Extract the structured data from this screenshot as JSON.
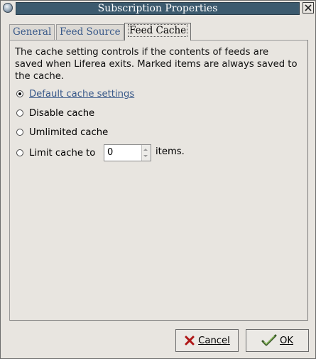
{
  "window": {
    "title": "Subscription Properties"
  },
  "tabs": [
    {
      "label": "General",
      "active": false
    },
    {
      "label": "Feed Source",
      "active": false
    },
    {
      "label": "Feed Cache",
      "active": true
    }
  ],
  "cache": {
    "description": "The cache setting controls if the contents of feeds are saved when Liferea exits. Marked items are always saved to the cache.",
    "options": [
      {
        "label": "Default cache settings",
        "accel": "D",
        "checked": true
      },
      {
        "label": "Disable cache",
        "accel": "s",
        "checked": false
      },
      {
        "label": "Umlimited cache",
        "accel": "U",
        "checked": false
      },
      {
        "label": "Limit cache to",
        "accel": "L",
        "checked": false
      }
    ],
    "limit_value": "0",
    "items_suffix": "items."
  },
  "buttons": {
    "cancel_label": "Cancel",
    "ok_label": "OK"
  },
  "colors": {
    "titlebar": "#3c5a6e",
    "accent_text": "#3a5a8a",
    "background": "#e8e5e0"
  },
  "icons": {
    "window": "window-menu-icon",
    "close": "close-icon",
    "cancel": "cancel-x-icon",
    "ok": "ok-check-icon"
  }
}
